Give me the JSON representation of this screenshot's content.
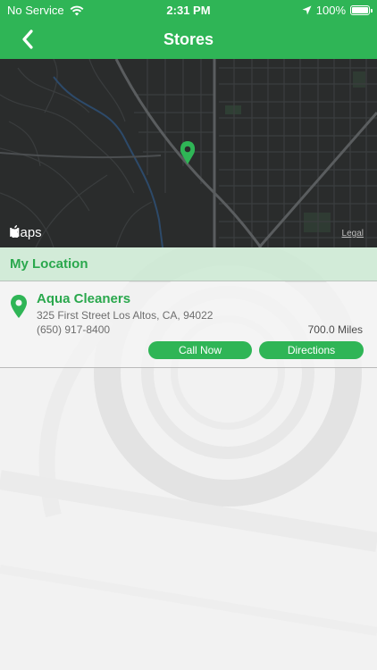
{
  "status_bar": {
    "carrier": "No Service",
    "time": "2:31 PM",
    "battery": "100%"
  },
  "nav": {
    "title": "Stores"
  },
  "map": {
    "logo_text": "Maps",
    "legal": "Legal"
  },
  "section": {
    "title": "My Location"
  },
  "store": {
    "name": "Aqua Cleaners",
    "address": "325 First Street Los Altos, CA, 94022",
    "phone": "(650) 917-8400",
    "distance": "700.0 Miles",
    "call_label": "Call Now",
    "directions_label": "Directions"
  },
  "colors": {
    "brand_green": "#2fb556",
    "map_background": "#2a2c2c"
  }
}
